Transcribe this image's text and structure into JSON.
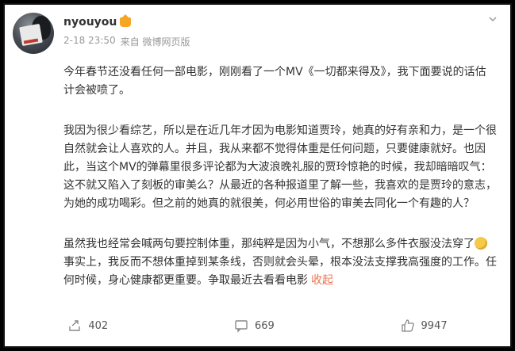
{
  "post": {
    "username": "nyouyou",
    "time": "2-18 23:50",
    "source": "来自 微博网页版",
    "paragraphs": [
      "今年春节还没看任何一部电影，刚刚看了一个MV《一切都来得及》，我下面要说的话估计会被喷了。",
      "我因为很少看综艺，所以是在近几年才因为电影知道贾玲，她真的好有亲和力，是一个很自然就会让人喜欢的人。并且，我从来都不觉得体重是任何问题，只要健康就好。也因此，当这个MV的弹幕里很多评论都为大波浪晚礼服的贾玲惊艳的时候，我却暗暗叹气：这不就又陷入了刻板的审美么？从最近的各种报道里了解一些，我喜欢的是贾玲的意志，为她的成功喝彩。但之前的她真的就很美，何必用世俗的审美去同化一个有趣的人？"
    ],
    "last_paragraph_before_emoji": "虽然我也经常会喊两句要控制体重，那纯粹是因为小气，不想那么多件衣服没法穿了",
    "last_paragraph_after_emoji": "事实上，我反而不想体重掉到某条线，否则就会头晕，根本没法支撑我高强度的工作。任何时候，身心健康都更重要。争取最近去看看电影",
    "collapse_label": "收起"
  },
  "actions": {
    "repost_count": "402",
    "comment_count": "669",
    "like_count": "9947"
  },
  "colors": {
    "accent": "#eb7350",
    "meta_gray": "#999999",
    "text": "#333333"
  }
}
